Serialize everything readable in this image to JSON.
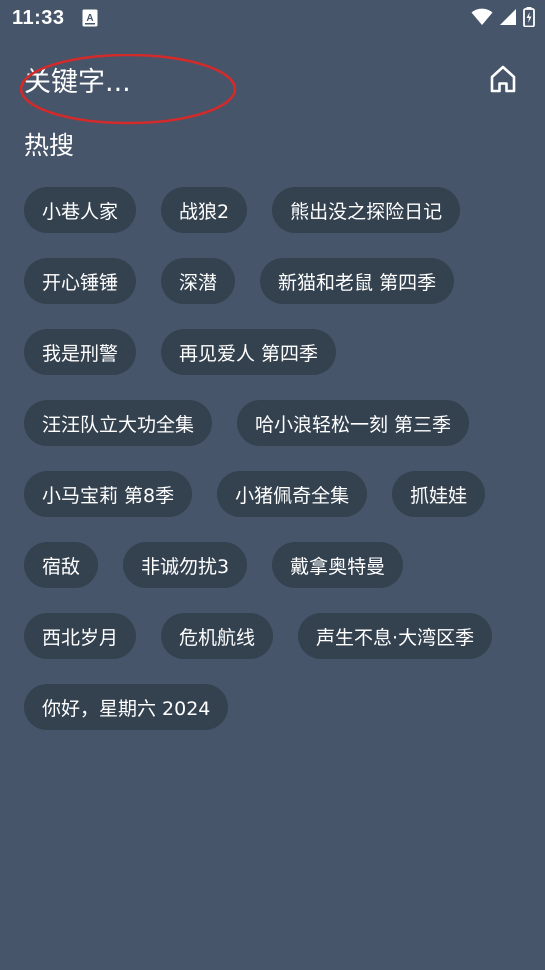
{
  "status_bar": {
    "time": "11:33",
    "notification_icon": "app-a-icon",
    "icons": [
      "wifi-icon",
      "signal-icon",
      "battery-charging-icon"
    ]
  },
  "search": {
    "placeholder": "关键字..."
  },
  "header": {
    "home_icon": "home-icon"
  },
  "hot_search": {
    "title": "热搜",
    "tags": [
      "小巷人家",
      "战狼2",
      "熊出没之探险日记",
      "开心锤锤",
      "深潜",
      "新猫和老鼠 第四季",
      "我是刑警",
      "再见爱人 第四季",
      "汪汪队立大功全集",
      "哈小浪轻松一刻 第三季",
      "小马宝莉 第8季",
      "小猪佩奇全集",
      "抓娃娃",
      "宿敌",
      "非诚勿扰3",
      "戴拿奥特曼",
      "西北岁月",
      "危机航线",
      "声生不息·大湾区季",
      "你好，星期六 2024"
    ]
  },
  "colors": {
    "background": "#465569",
    "tag_background": "#34414f",
    "text": "#ffffff",
    "annotation": "#d42a2a"
  }
}
